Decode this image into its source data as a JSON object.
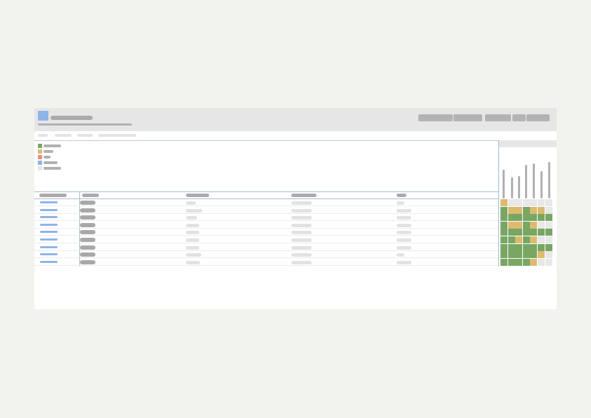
{
  "app": {
    "brand_color": "#8fb4e8"
  },
  "header": {
    "actions": [
      "",
      "",
      "",
      "",
      ""
    ]
  },
  "filters": [
    "",
    "",
    "",
    ""
  ],
  "legend": [
    {
      "color": "#78a764"
    },
    {
      "color": "#ddbb6e"
    },
    {
      "color": "#e8907c"
    },
    {
      "color": "#8fb4e8"
    },
    {
      "color": "#e6e6e6"
    }
  ],
  "table": {
    "columns": [
      "",
      "",
      "",
      "",
      ""
    ],
    "rows": [
      [
        "",
        "",
        "",
        "",
        ""
      ],
      [
        "",
        "",
        "",
        "",
        ""
      ],
      [
        "",
        "",
        "",
        "",
        ""
      ],
      [
        "",
        "",
        "",
        "",
        ""
      ],
      [
        "",
        "",
        "",
        "",
        ""
      ],
      [
        "",
        "",
        "",
        "",
        ""
      ],
      [
        "",
        "",
        "",
        "",
        ""
      ],
      [
        "",
        "",
        "",
        "",
        ""
      ],
      [
        "",
        "",
        "",
        "",
        ""
      ]
    ]
  },
  "side_panel": {
    "spark_levels": [
      0.78,
      0.56,
      0.6,
      0.9,
      0.95,
      0.74,
      0.98
    ],
    "status_grid": [
      [
        "y",
        "e",
        "e",
        "e",
        "e",
        "e",
        "e"
      ],
      [
        "g",
        "y",
        "y",
        "g",
        "y",
        "y",
        "e"
      ],
      [
        "g",
        "g",
        "g",
        "g",
        "g",
        "g",
        "g"
      ],
      [
        "g",
        "y",
        "y",
        "g",
        "y",
        "e",
        "e"
      ],
      [
        "g",
        "g",
        "g",
        "g",
        "g",
        "g",
        "g"
      ],
      [
        "g",
        "g",
        "y",
        "g",
        "y",
        "e",
        "e"
      ],
      [
        "g",
        "g",
        "g",
        "g",
        "g",
        "g",
        "g"
      ],
      [
        "g",
        "g",
        "g",
        "g",
        "g",
        "y",
        "e"
      ],
      [
        "g",
        "g",
        "g",
        "g",
        "y",
        "e",
        "e"
      ]
    ],
    "status_colors": {
      "g": "#78a764",
      "y": "#ddbb6e",
      "e": "#e8e8e8"
    }
  }
}
